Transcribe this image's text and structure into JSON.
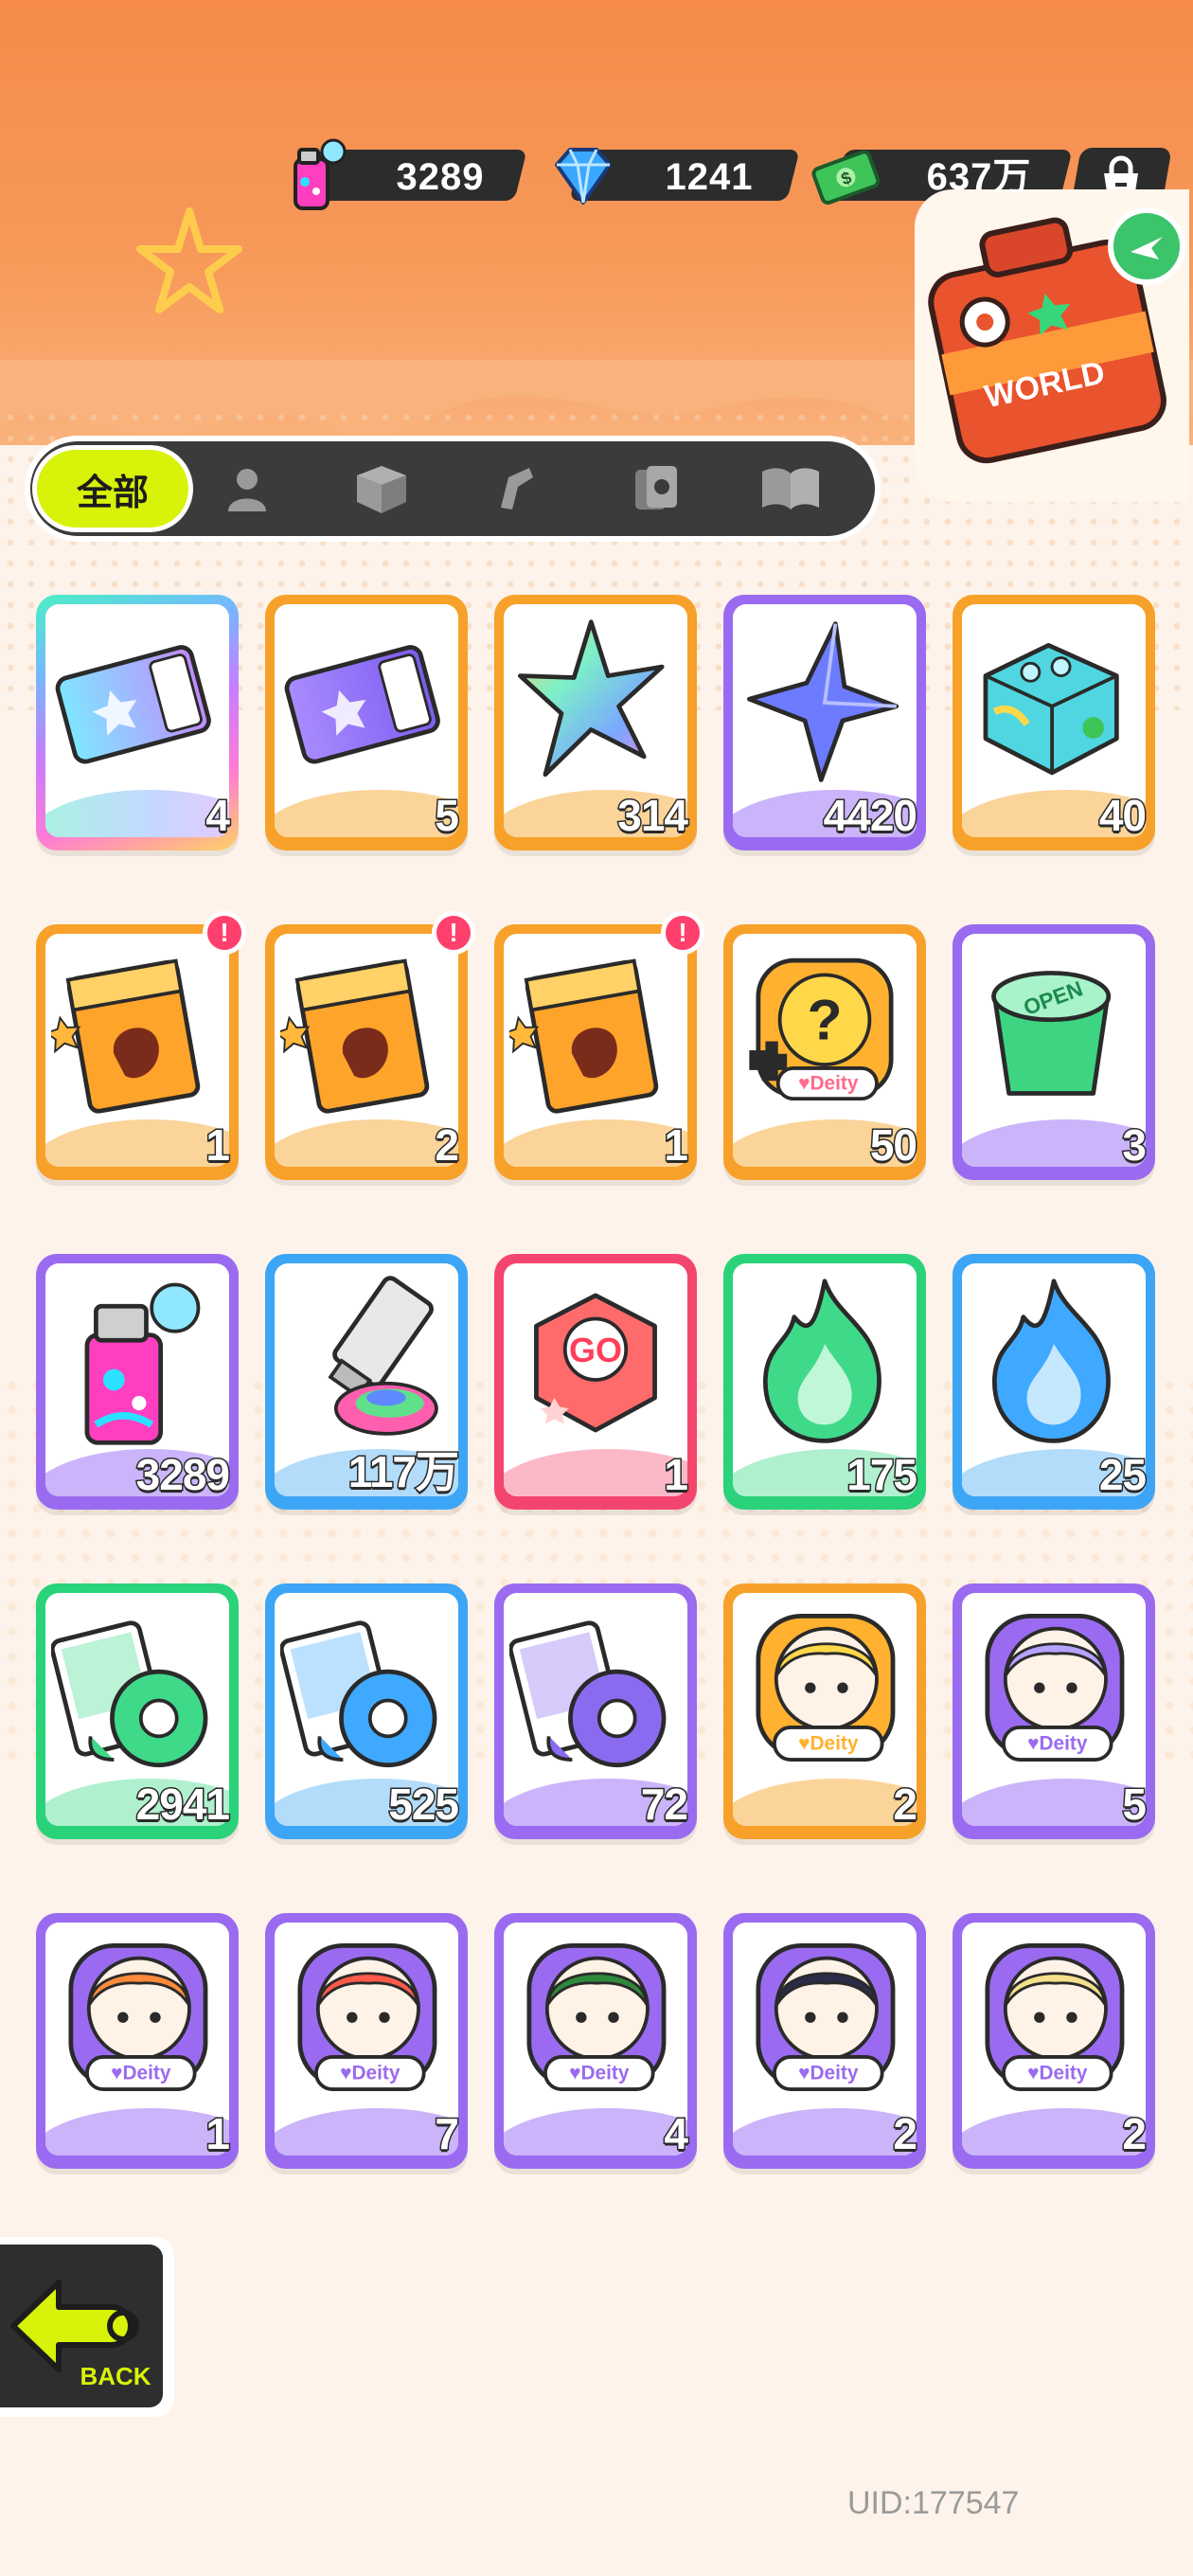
{
  "currencies": [
    {
      "id": "spray",
      "icon": "spray-can-icon",
      "value": "3289"
    },
    {
      "id": "gem",
      "icon": "diamond-icon",
      "value": "1241"
    },
    {
      "id": "cash",
      "icon": "cash-icon",
      "value": "637万"
    }
  ],
  "shop": {
    "icon": "shop-bag-icon"
  },
  "world_event": {
    "icon": "world-chest-icon",
    "label": "WORLD"
  },
  "tabs": [
    {
      "id": "all",
      "label": "全部",
      "icon": "",
      "active": true
    },
    {
      "id": "character",
      "label": "",
      "icon": "person-icon"
    },
    {
      "id": "box",
      "label": "",
      "icon": "box-icon"
    },
    {
      "id": "spray",
      "label": "",
      "icon": "spray-gun-icon"
    },
    {
      "id": "cards",
      "label": "",
      "icon": "cards-icon"
    },
    {
      "id": "book",
      "label": "",
      "icon": "book-icon"
    }
  ],
  "items": [
    {
      "art": "rainbow-ticket-icon",
      "frame": "rainbow",
      "count": "4",
      "alert": false
    },
    {
      "art": "purple-ticket-icon",
      "frame": "orange",
      "count": "5",
      "alert": false
    },
    {
      "art": "rainbow-star-icon",
      "frame": "orange",
      "count": "314",
      "alert": false
    },
    {
      "art": "blue-star-icon",
      "frame": "purple",
      "count": "4420",
      "alert": false
    },
    {
      "art": "color-block-icon",
      "frame": "orange",
      "count": "40",
      "alert": false
    },
    {
      "art": "deity-pack-icon",
      "frame": "orange",
      "count": "1",
      "alert": true
    },
    {
      "art": "deity-pack-icon",
      "frame": "orange",
      "count": "2",
      "alert": true
    },
    {
      "art": "deity-pack-icon",
      "frame": "orange",
      "count": "1",
      "alert": true
    },
    {
      "art": "mystery-deity-icon",
      "frame": "orange",
      "count": "50",
      "alert": false
    },
    {
      "art": "open-cup-icon",
      "frame": "purple",
      "count": "3",
      "alert": false
    },
    {
      "art": "spray-can-icon",
      "frame": "purple",
      "count": "3289",
      "alert": false
    },
    {
      "art": "paint-tube-icon",
      "frame": "blue",
      "count": "117万",
      "alert": false
    },
    {
      "art": "go-dice-icon",
      "frame": "pink",
      "count": "1",
      "alert": false
    },
    {
      "art": "green-flame-icon",
      "frame": "green",
      "count": "175",
      "alert": false
    },
    {
      "art": "blue-flame-icon",
      "frame": "blue",
      "count": "25",
      "alert": false
    },
    {
      "art": "green-tape-cards-icon",
      "frame": "green",
      "count": "2941",
      "alert": false
    },
    {
      "art": "blue-tape-cards-icon",
      "frame": "blue",
      "count": "525",
      "alert": false
    },
    {
      "art": "purple-tape-cards-icon",
      "frame": "purple",
      "count": "72",
      "alert": false
    },
    {
      "art": "deity-badge-blonde-icon",
      "frame": "orange",
      "count": "2",
      "alert": false
    },
    {
      "art": "deity-badge-lavender-icon",
      "frame": "purple",
      "count": "5",
      "alert": false
    },
    {
      "art": "deity-badge-orange-hair-icon",
      "frame": "purple",
      "count": "1",
      "alert": false
    },
    {
      "art": "deity-badge-red-hair-icon",
      "frame": "purple",
      "count": "7",
      "alert": false
    },
    {
      "art": "deity-badge-goggles-icon",
      "frame": "purple",
      "count": "4",
      "alert": false
    },
    {
      "art": "deity-badge-dark-icon",
      "frame": "purple",
      "count": "2",
      "alert": false
    },
    {
      "art": "deity-badge-glasses-icon",
      "frame": "purple",
      "count": "2",
      "alert": false
    }
  ],
  "badge_text": "!",
  "deity_label": "Deity",
  "back": {
    "label": "BACK",
    "icon": "back-arrow-icon"
  },
  "uid": "UID:177547"
}
